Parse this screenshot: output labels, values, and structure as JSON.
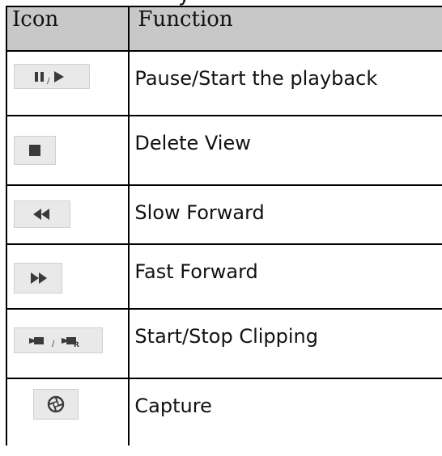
{
  "caption": "y",
  "table": {
    "headers": {
      "icon": "Icon",
      "function": "Function"
    },
    "rows": [
      {
        "icon": "pause-play-icon",
        "function": "Pause/Start the playback"
      },
      {
        "icon": "stop-icon",
        "function": "Delete View"
      },
      {
        "icon": "rewind-icon",
        "function": "Slow Forward"
      },
      {
        "icon": "fast-forward-icon",
        "function": "Fast Forward"
      },
      {
        "icon": "clip-start-stop-icon",
        "function": "Start/Stop Clipping"
      },
      {
        "icon": "camera-shutter-icon",
        "function": "Capture"
      }
    ]
  },
  "colors": {
    "header_bg": "#c8c8c8",
    "icon_button_bg": "#e9e9e9",
    "border": "#000000",
    "icon_fill": "#3a3a3a"
  }
}
